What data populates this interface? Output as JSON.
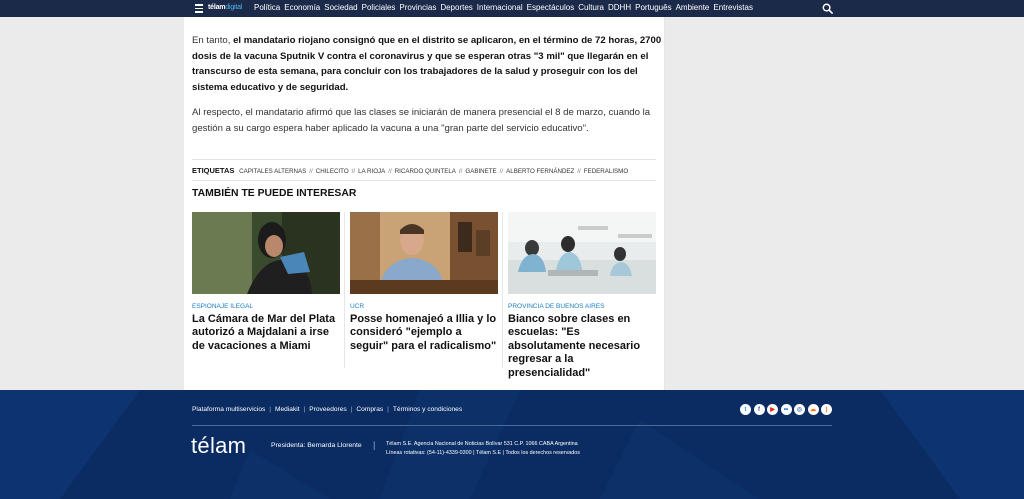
{
  "nav": {
    "logo": "télam",
    "logo_suffix": "digital",
    "items": [
      "Política",
      "Economía",
      "Sociedad",
      "Policiales",
      "Provincias",
      "Deportes",
      "Internacional",
      "Espectáculos",
      "Cultura",
      "DDHH",
      "Português",
      "Ambiente",
      "Entrevistas"
    ]
  },
  "article": {
    "p1_a": "En tanto, ",
    "p1_b": "el mandatario riojano consignó que en el distrito se aplicaron, en el término de 72 horas, 2700 dosis de la vacuna Sputnik V contra el coronavirus y que se esperan otras \"3 mil\" que llegarán en el transcurso de esta semana, para concluir con los trabajadores de la salud y proseguir con los del sistema educativo y de seguridad.",
    "p2": "Al respecto, el mandatario afirmó que las clases se iniciarán de manera presencial el 8 de marzo, cuando la gestión a su cargo espera haber aplicado la vacuna a una \"gran parte del servicio educativo\"."
  },
  "tags": {
    "label": "ETIQUETAS",
    "items": [
      "CAPITALES ALTERNAS",
      "CHILECITO",
      "LA RIOJA",
      "RICARDO QUINTELA",
      "GABINETE",
      "ALBERTO FERNÁNDEZ",
      "FEDERALISMO"
    ],
    "separator": "//"
  },
  "related": {
    "title": "TAMBIÉN TE PUEDE INTERESAR",
    "cards": [
      {
        "category": "ESPIONAJE ILEGAL",
        "headline": "La Cámara de Mar del Plata autorizó a Majdalani a irse de vacaciones a Miami"
      },
      {
        "category": "UCR",
        "headline": "Posse homenajeó a Illia y lo consideró \"ejemplo a seguir\" para el radicalismo\""
      },
      {
        "category": "PROVINCIA DE BUENOS AIRES",
        "headline": "Bianco sobre clases en escuelas: \"Es absolutamente necesario regresar a la presencialidad\""
      }
    ]
  },
  "footer": {
    "links": [
      "Plataforma multiservicios",
      "Mediakit",
      "Proveedores",
      "Compras",
      "Términos y condiciones"
    ],
    "logo": "télam",
    "president": "Presidenta: Bernarda Llorente",
    "info_line1": "Télam S.E. Agencia Nacional de Noticias Bolívar 531 C.P. 1066 CABA Argentina",
    "info_line2": "Líneas rotativas: (54-11)-4339-0300  |  Télam S.E  |  Todos los derechos reservados",
    "social": [
      "twitter-icon",
      "facebook-icon",
      "youtube-icon",
      "flickr-icon",
      "instagram-icon",
      "soundcloud-icon",
      "rss-icon"
    ]
  },
  "colors": {
    "nav_bg": "#1c2a4a",
    "footer_bg": "#0a2c63",
    "category": "#1a7fc1",
    "page_bg": "#ebebeb"
  }
}
